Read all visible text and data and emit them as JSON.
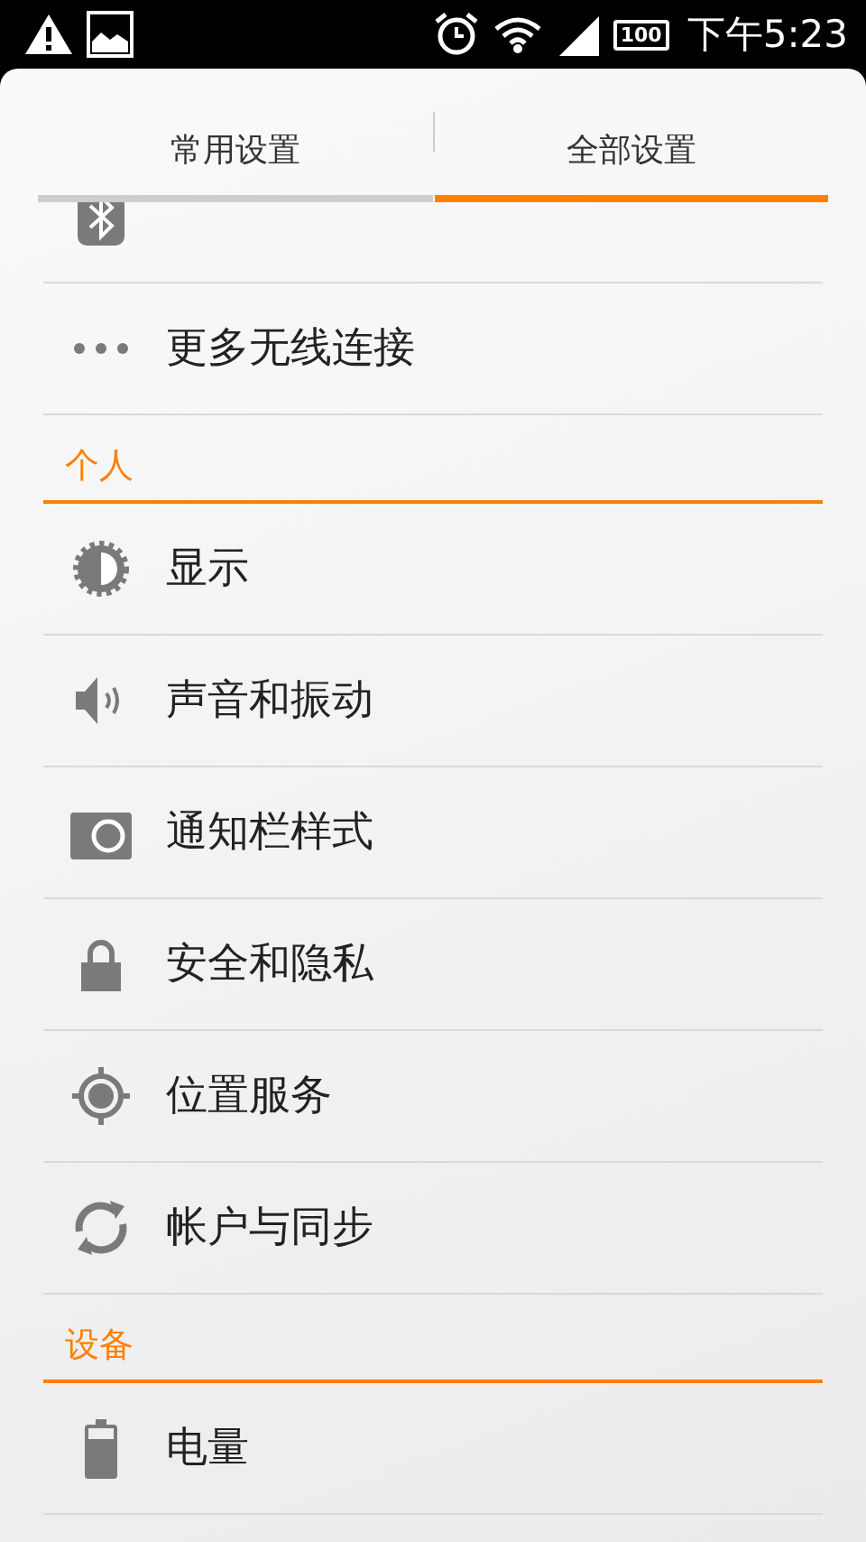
{
  "status_bar": {
    "battery": "100",
    "time": "下午5:23"
  },
  "tabs": [
    {
      "label": "常用设置",
      "selected": false
    },
    {
      "label": "全部设置",
      "selected": true
    }
  ],
  "list": [
    {
      "kind": "item"
    },
    {
      "kind": "item",
      "label": "更多无线连接"
    },
    {
      "kind": "header",
      "label": "个人"
    },
    {
      "kind": "item",
      "label": "显示"
    },
    {
      "kind": "item",
      "label": "声音和振动"
    },
    {
      "kind": "item",
      "label": "通知栏样式"
    },
    {
      "kind": "item",
      "label": "安全和隐私"
    },
    {
      "kind": "item",
      "label": "位置服务"
    },
    {
      "kind": "item",
      "label": "帐户与同步"
    },
    {
      "kind": "header",
      "label": "设备"
    },
    {
      "kind": "item",
      "label": "电量"
    }
  ]
}
